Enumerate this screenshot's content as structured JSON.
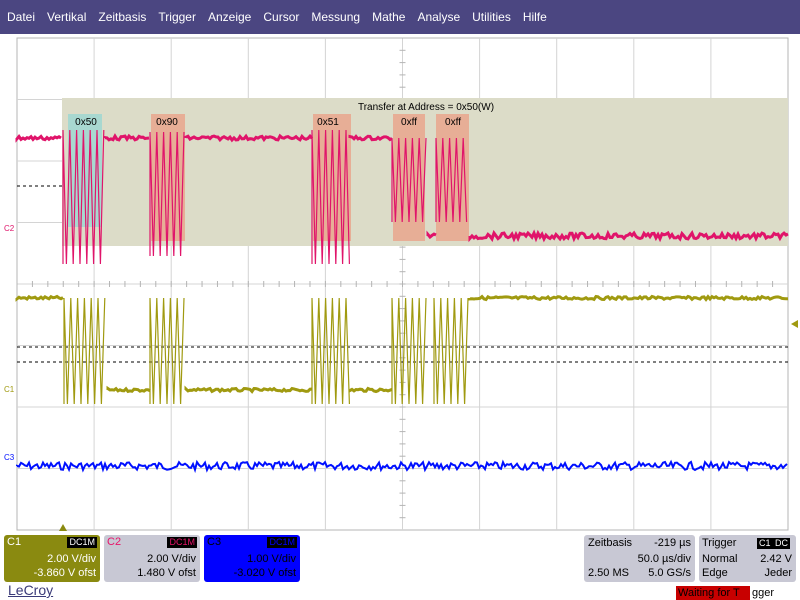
{
  "menu": [
    "Datei",
    "Vertikal",
    "Zeitbasis",
    "Trigger",
    "Anzeige",
    "Cursor",
    "Messung",
    "Mathe",
    "Analyse",
    "Utilities",
    "Hilfe"
  ],
  "colors": {
    "c1": "#a09a10",
    "c2": "#e0146a",
    "c3": "#0010ff",
    "decode_band": "#dcdcc8",
    "decode_byte": "#e8a890",
    "decode_addr": "#a8d8d0",
    "menubar": "#4b4681"
  },
  "decode": {
    "title": "Transfer at Address = 0x50(W)",
    "bytes": [
      "0x50",
      "0x90",
      "0x51",
      "0xff",
      "0xff"
    ]
  },
  "channel_tags": {
    "c1": "C1",
    "c2": "C2",
    "c3": "C3"
  },
  "channels": [
    {
      "name": "C1",
      "coupling": "DC1M",
      "vdiv": "2.00 V/div",
      "offset": "-3.860 V ofst"
    },
    {
      "name": "C2",
      "coupling": "DC1M",
      "vdiv": "2.00 V/div",
      "offset": "1.480 V ofst"
    },
    {
      "name": "C3",
      "coupling": "DC1M",
      "vdiv": "1.00 V/div",
      "offset": "-3.020 V ofst"
    }
  ],
  "timebase": {
    "label": "Zeitbasis",
    "delay": "-219 µs",
    "tdiv": "50.0 µs/div",
    "samples": "2.50 MS",
    "rate": "5.0 GS/s"
  },
  "trigger": {
    "label": "Trigger",
    "source": "C1",
    "coupling": "DC",
    "mode": "Normal",
    "level": "2.42 V",
    "type": "Edge",
    "slope": "Jeder"
  },
  "logo": "LeCroy",
  "status": {
    "highlight": "Waiting for T",
    "rest": "gger"
  }
}
